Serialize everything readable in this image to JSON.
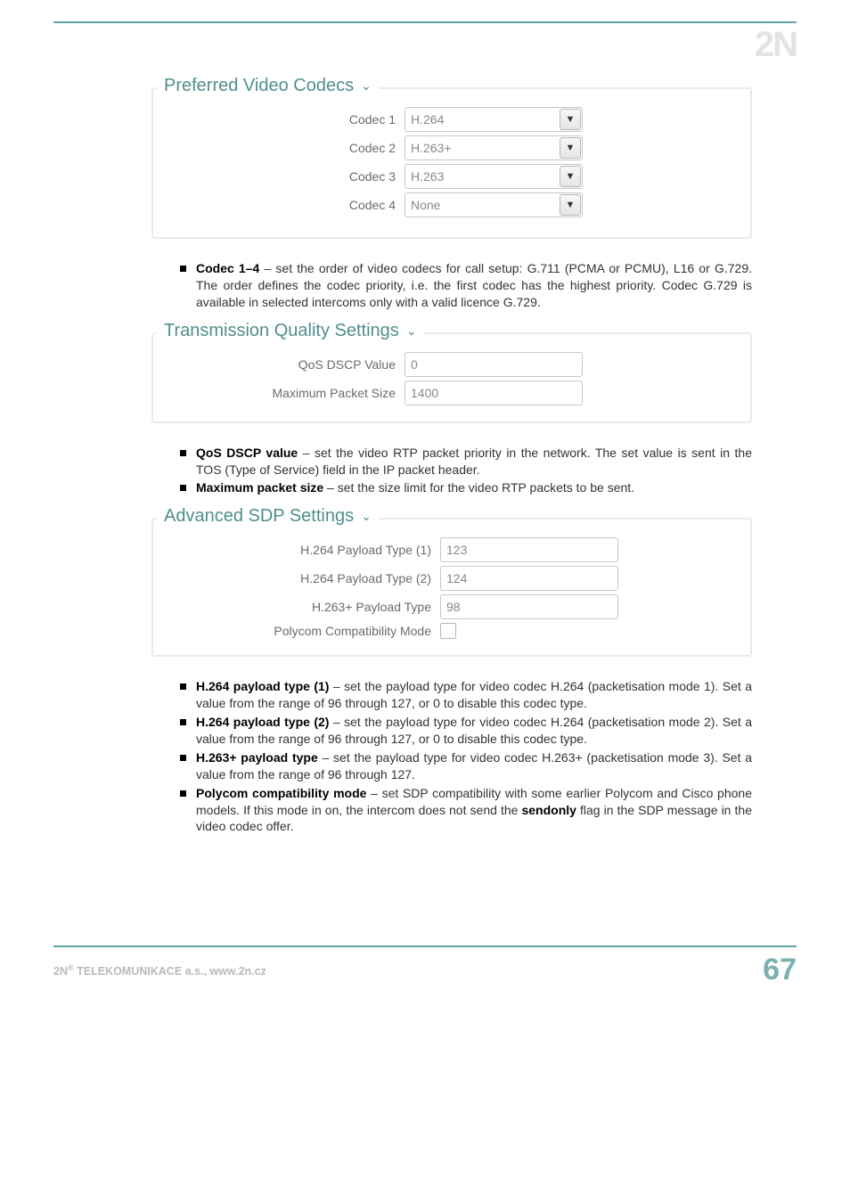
{
  "logo": "2N",
  "section1": {
    "legend": "Preferred Video Codecs",
    "rows": [
      {
        "label": "Codec 1",
        "value": "H.264"
      },
      {
        "label": "Codec 2",
        "value": "H.263+"
      },
      {
        "label": "Codec 3",
        "value": "H.263"
      },
      {
        "label": "Codec 4",
        "value": "None"
      }
    ]
  },
  "bullets1": [
    {
      "term": "Codec 1–4",
      "text": " – set the order of video codecs for call setup: G.711 (PCMA or PCMU), L16 or G.729. The order defines the codec priority, i.e. the first codec has the highest priority. Codec G.729 is available in selected intercoms only with a valid licence G.729."
    }
  ],
  "section2": {
    "legend": "Transmission Quality Settings",
    "rows": [
      {
        "label": "QoS DSCP Value",
        "value": "0"
      },
      {
        "label": "Maximum Packet Size",
        "value": "1400"
      }
    ]
  },
  "bullets2": [
    {
      "term": "QoS DSCP value",
      "text": " – set the video RTP packet priority in the network. The set value is sent in the TOS (Type of Service) field in the IP packet header."
    },
    {
      "term": "Maximum packet size",
      "text": " – set the size limit for the video RTP packets to be sent."
    }
  ],
  "section3": {
    "legend": "Advanced SDP Settings",
    "rows": [
      {
        "label": "H.264 Payload Type (1)",
        "value": "123"
      },
      {
        "label": "H.264 Payload Type (2)",
        "value": "124"
      },
      {
        "label": "H.263+ Payload Type",
        "value": "98"
      },
      {
        "label": "Polycom Compatibility Mode",
        "type": "checkbox"
      }
    ]
  },
  "bullets3": [
    {
      "term": "H.264 payload type (1)",
      "text": " – set the payload type for video codec H.264 (packetisation mode 1). Set a value from the range of 96 through 127, or 0 to disable this codec type."
    },
    {
      "term": "H.264 payload type (2)",
      "text": " – set the payload type for video codec H.264 (packetisation mode 2). Set a value from the range of 96 through 127, or 0 to disable this codec type."
    },
    {
      "term": "H.263+ payload type",
      "text": " – set the payload type for video codec H.263+ (packetisation mode 3). Set a value from the range of 96 through 127."
    },
    {
      "term": "Polycom compatibility mode",
      "text": " – set SDP compatibility with some earlier Polycom and Cisco phone models. If this mode in on, the intercom does not send the ",
      "term2": "sendonly",
      "text2": " flag in the SDP message in the video codec offer."
    }
  ],
  "footer": {
    "company_pre": "2N",
    "company_sup": "®",
    "company_post": " TELEKOMUNIKACE a.s., www.2n.cz",
    "page": "67"
  }
}
